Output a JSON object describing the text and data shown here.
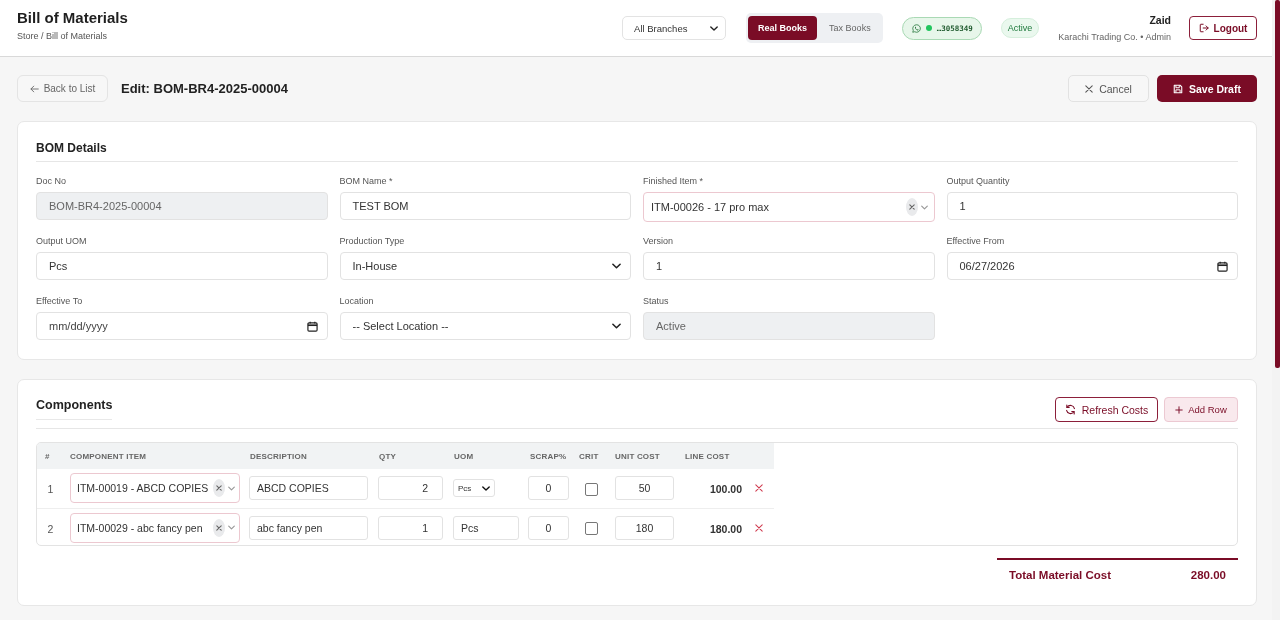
{
  "header": {
    "title": "Bill of Materials",
    "breadcrumb": "Store / Bill of Materials",
    "branch_select": "All Branches",
    "books": [
      {
        "label": "Real Books",
        "selected": true
      },
      {
        "label": "Tax Books",
        "selected": false
      }
    ],
    "whatsapp": {
      "number": "…3058349",
      "connected": true
    },
    "status": "Active",
    "user": {
      "name": "Zaid",
      "subtitle": "Karachi Trading Co. • Admin"
    },
    "logout": "Logout"
  },
  "toolbar": {
    "back": "Back to List",
    "title": "Edit: BOM-BR4-2025-00004",
    "buttons": [
      {
        "label": "Cancel",
        "kind": "cancel"
      },
      {
        "label": "Save Draft",
        "kind": "save"
      }
    ]
  },
  "bom_details": {
    "title": "BOM Details",
    "fields": [
      {
        "label": "Doc No",
        "kind": "text",
        "value": "BOM-BR4-2025-00004",
        "disabled": true
      },
      {
        "label": "BOM Name *",
        "kind": "text",
        "value": "TEST BOM",
        "disabled": false
      },
      {
        "label": "Finished Item *",
        "kind": "combo",
        "value": "ITM-00026 - 17 pro max",
        "disabled": false
      },
      {
        "label": "Output Quantity",
        "kind": "text",
        "value": "1",
        "disabled": false
      },
      {
        "label": "Output UOM",
        "kind": "text",
        "value": "Pcs",
        "disabled": false
      },
      {
        "label": "Production Type",
        "kind": "select",
        "value": "In-House",
        "disabled": false
      },
      {
        "label": "Version",
        "kind": "text",
        "value": "1",
        "disabled": false
      },
      {
        "label": "Effective From",
        "kind": "date",
        "value": "06/27/2026",
        "disabled": false
      },
      {
        "label": "Effective To",
        "kind": "date",
        "placeholder": "mm/dd/yyyy",
        "disabled": false
      },
      {
        "label": "Location",
        "kind": "select",
        "value": "-- Select Location --",
        "disabled": false
      },
      {
        "label": "Status",
        "kind": "text",
        "value": "Active",
        "disabled": true
      }
    ]
  },
  "components": {
    "title": "Components",
    "buttons": [
      {
        "label": "Refresh Costs",
        "kind": "refresh"
      },
      {
        "label": "Add Row",
        "kind": "add"
      }
    ],
    "columns": [
      "#",
      "COMPONENT ITEM",
      "DESCRIPTION",
      "QTY",
      "UOM",
      "SCRAP%",
      "CRIT",
      "UNIT COST",
      "LINE COST"
    ],
    "rows": [
      {
        "no": "1",
        "item": "ITM-00019 - ABCD COPIES",
        "description": "ABCD COPIES",
        "qty": "2",
        "uom": {
          "kind": "select",
          "value": "Pcs"
        },
        "scrap": "0",
        "critical": false,
        "unit_cost": "50",
        "line_cost": "100.00"
      },
      {
        "no": "2",
        "item": "ITM-00029 - abc fancy pen",
        "description": "abc fancy pen",
        "qty": "1",
        "uom": {
          "kind": "text",
          "value": "Pcs"
        },
        "scrap": "0",
        "critical": false,
        "unit_cost": "180",
        "line_cost": "180.00"
      }
    ],
    "total": {
      "label": "Total Material Cost",
      "value": "280.00"
    }
  }
}
